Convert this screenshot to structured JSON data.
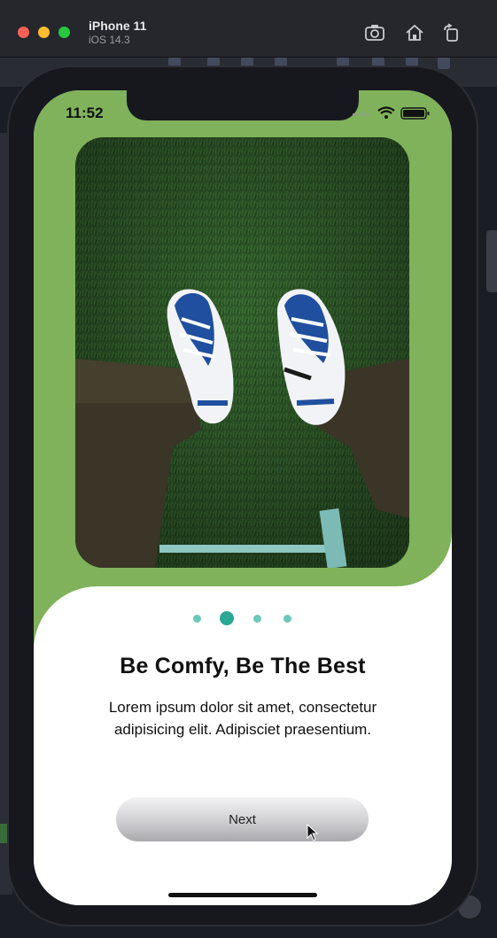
{
  "simulator": {
    "device_name": "iPhone 11",
    "os_version": "iOS 14.3",
    "toolbar_icons": [
      "screenshot-icon",
      "home-icon",
      "rotate-icon"
    ]
  },
  "status_bar": {
    "time": "11:52",
    "icons": [
      "cellular-icon",
      "wifi-icon",
      "battery-icon"
    ]
  },
  "onboarding": {
    "image_alt": "Sneakers on grass",
    "page_dots": {
      "count": 4,
      "active_index": 1
    },
    "title": "Be Comfy, Be The Best",
    "description": "Lorem ipsum dolor sit amet, consectetur adipisicing elit. Adipisciet praesentium.",
    "next_label": "Next"
  },
  "colors": {
    "brand_green": "#7fb25a",
    "dot_active": "#2ba893",
    "dot_inactive": "#6dc8b8"
  }
}
